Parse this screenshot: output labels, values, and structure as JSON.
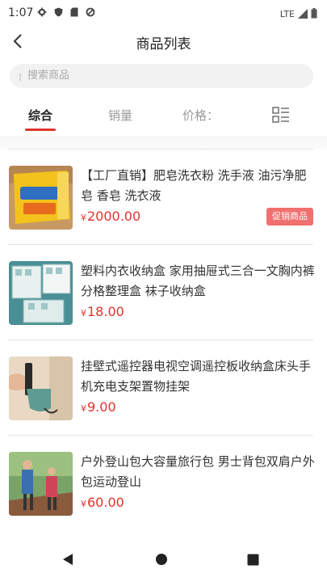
{
  "status_bar": {
    "time": "1:07",
    "network": "LTE",
    "icons": [
      "gear-icon",
      "shield-icon",
      "sim-card-icon",
      "data-saver-icon",
      "signal-icon",
      "battery-icon"
    ]
  },
  "header": {
    "title": "商品列表",
    "back_icon": "chevron-left-icon"
  },
  "search": {
    "placeholder": "搜索商品"
  },
  "tabs": [
    {
      "label": "综合",
      "active": true
    },
    {
      "label": "销量",
      "active": false
    },
    {
      "label": "价格：",
      "active": false
    }
  ],
  "layout_toggle_icon": "list-layout-icon",
  "products": [
    {
      "name": "【工厂直销】肥皂洗衣粉 洗手液 油污净肥皂 香皂 洗衣液",
      "currency": "¥",
      "price": "2000.00",
      "badge": "促销商品"
    },
    {
      "name": "塑料内衣收纳盒 家用抽屉式三合一文胸内裤分格整理盒 袜子收纳盒",
      "currency": "¥",
      "price": "18.00",
      "badge": ""
    },
    {
      "name": "挂壁式遥控器电视空调遥控板收纳盒床头手机充电支架置物挂架",
      "currency": "¥",
      "price": "9.00",
      "badge": ""
    },
    {
      "name": "户外登山包大容量旅行包 男士背包双肩户外包运动登山",
      "currency": "¥",
      "price": "60.00",
      "badge": ""
    }
  ],
  "colors": {
    "accent": "#e0332e",
    "badge_bg": "#f07070"
  }
}
